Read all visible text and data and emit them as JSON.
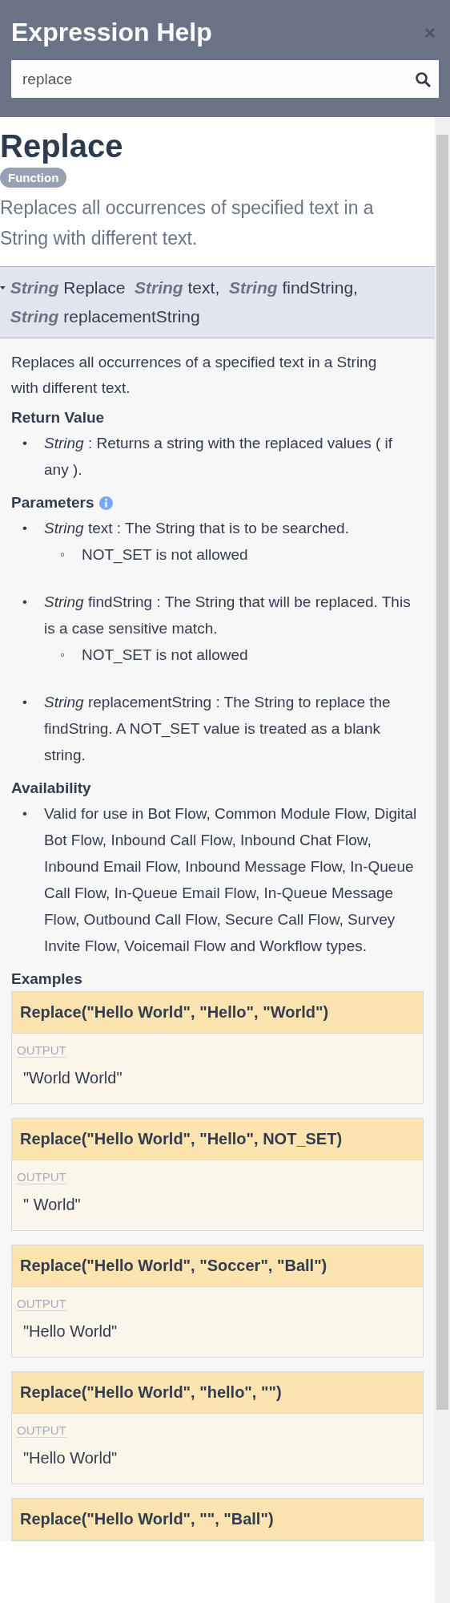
{
  "header": {
    "title": "Expression Help",
    "search": {
      "value": "replace"
    }
  },
  "function": {
    "name": "Replace",
    "badge": "Function",
    "description": "Replaces all occurrences of specified text in a String with different text."
  },
  "signature": {
    "expanded": true,
    "parts": [
      {
        "kind": "type",
        "text": "String"
      },
      {
        "kind": "name",
        "text": "Replace"
      },
      {
        "kind": "type",
        "text": "String"
      },
      {
        "kind": "name",
        "text": "text,"
      },
      {
        "kind": "type",
        "text": "String"
      },
      {
        "kind": "name",
        "text": "findString,"
      },
      {
        "kind": "type",
        "text": "String"
      },
      {
        "kind": "name",
        "text": "replacementString"
      }
    ]
  },
  "details": {
    "summary": "Replaces all occurrences of a specified text in a String with different text.",
    "return_value": {
      "heading": "Return Value",
      "items": [
        {
          "marker": "•",
          "text": "*String* : Returns a string with the replaced values ( if any )."
        }
      ]
    },
    "parameters": {
      "heading": "Parameters",
      "items": [
        {
          "marker": "•",
          "text": "*String*  text : The String that is to be searched.",
          "children": [
            {
              "marker": "◦",
              "text": "NOT_SET is not allowed"
            }
          ]
        },
        {
          "marker": "•",
          "text": "*String*  findString : The String that will be replaced. This is a case sensitive match.",
          "children": [
            {
              "marker": "◦",
              "text": "NOT_SET is not allowed"
            }
          ]
        },
        {
          "marker": "•",
          "text": "*String*  replacementString : The String to replace the findString. A NOT_SET value is treated as a blank string."
        }
      ]
    },
    "availability": {
      "heading": "Availability",
      "items": [
        {
          "marker": "•",
          "text": "Valid for use in Bot Flow, Common Module Flow, Digital Bot Flow, Inbound Call Flow, Inbound Chat Flow, Inbound Email Flow, Inbound Message Flow, In-Queue Call Flow, In-Queue Email Flow, In-Queue Message Flow, Outbound Call Flow, Secure Call Flow, Survey Invite Flow, Voicemail Flow and Workflow types."
        }
      ]
    },
    "examples": {
      "heading": "Examples",
      "items": [
        {
          "code": "Replace(\"Hello World\", \"Hello\", \"World\")",
          "output_label": "OUTPUT",
          "output": "\"World World\""
        },
        {
          "code": "Replace(\"Hello World\", \"Hello\", NOT_SET)",
          "output_label": "OUTPUT",
          "output": "\" World\""
        },
        {
          "code": "Replace(\"Hello World\", \"Soccer\", \"Ball\")",
          "output_label": "OUTPUT",
          "output": "\"Hello World\""
        },
        {
          "code": "Replace(\"Hello World\", \"hello\", \"\")",
          "output_label": "OUTPUT",
          "output": "\"Hello World\""
        },
        {
          "code": "Replace(\"Hello World\", \"\", \"Ball\")"
        }
      ]
    }
  }
}
